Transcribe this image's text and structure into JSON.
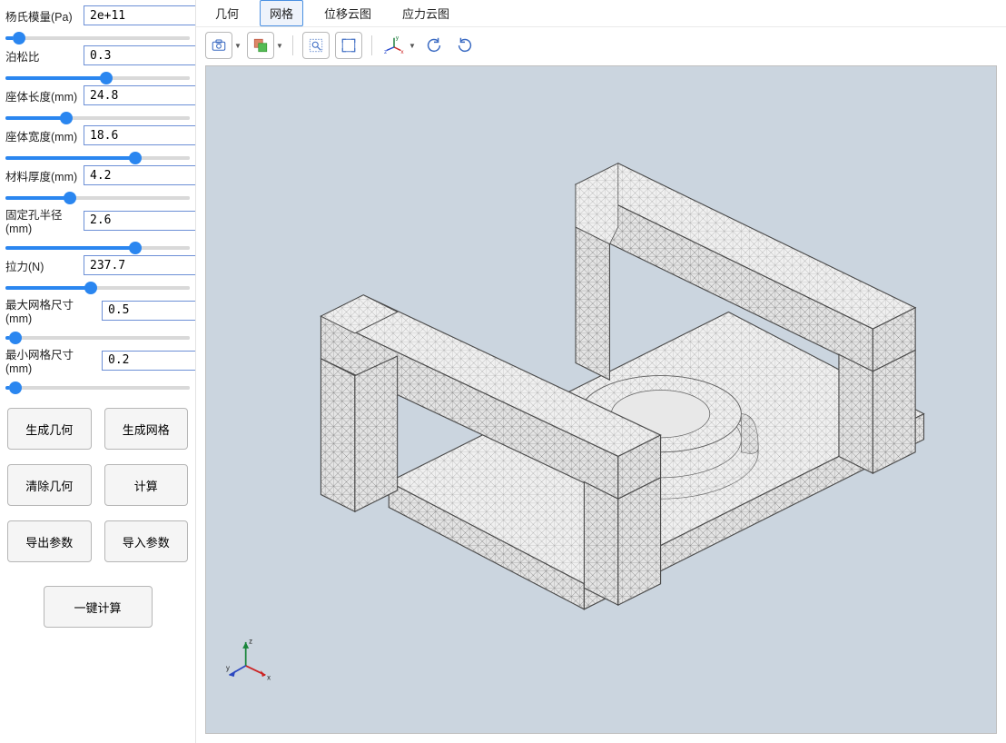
{
  "sidebar": {
    "params": [
      {
        "label": "杨氏模量(Pa)",
        "value": "2e+11",
        "slider_pct": 4
      },
      {
        "label": "泊松比",
        "value": "0.3",
        "slider_pct": 55
      },
      {
        "label": "座体长度(mm)",
        "value": "24.8",
        "slider_pct": 32
      },
      {
        "label": "座体宽度(mm)",
        "value": "18.6",
        "slider_pct": 72
      },
      {
        "label": "材料厚度(mm)",
        "value": "4.2",
        "slider_pct": 34
      },
      {
        "label": "固定孔半径(mm)",
        "value": "2.6",
        "slider_pct": 72
      },
      {
        "label": "拉力(N)",
        "value": "237.7",
        "slider_pct": 46
      },
      {
        "label": "最大网格尺寸(mm)",
        "value": "0.5",
        "slider_pct": 2
      },
      {
        "label": "最小网格尺寸(mm)",
        "value": "0.2",
        "slider_pct": 2
      }
    ],
    "buttons": {
      "gen_geom": "生成几何",
      "gen_mesh": "生成网格",
      "clear_geom": "清除几何",
      "compute": "计算",
      "export": "导出参数",
      "import": "导入参数",
      "one_click": "一键计算"
    }
  },
  "tabs": [
    {
      "id": "geom",
      "label": "几何",
      "active": false
    },
    {
      "id": "mesh",
      "label": "网格",
      "active": true
    },
    {
      "id": "disp",
      "label": "位移云图",
      "active": false
    },
    {
      "id": "stress",
      "label": "应力云图",
      "active": false
    }
  ],
  "toolbar": {
    "screenshot": "screenshot-icon",
    "transparency": "transparency-icon",
    "zoom_box": "zoom-box-icon",
    "zoom_extents": "zoom-extents-icon",
    "axes_xyz": "axes-xyz-icon",
    "rotate_ccw": "rotate-ccw-icon",
    "rotate_cw": "rotate-cw-icon"
  },
  "axes": {
    "x": "x",
    "y": "y",
    "z": "z"
  }
}
